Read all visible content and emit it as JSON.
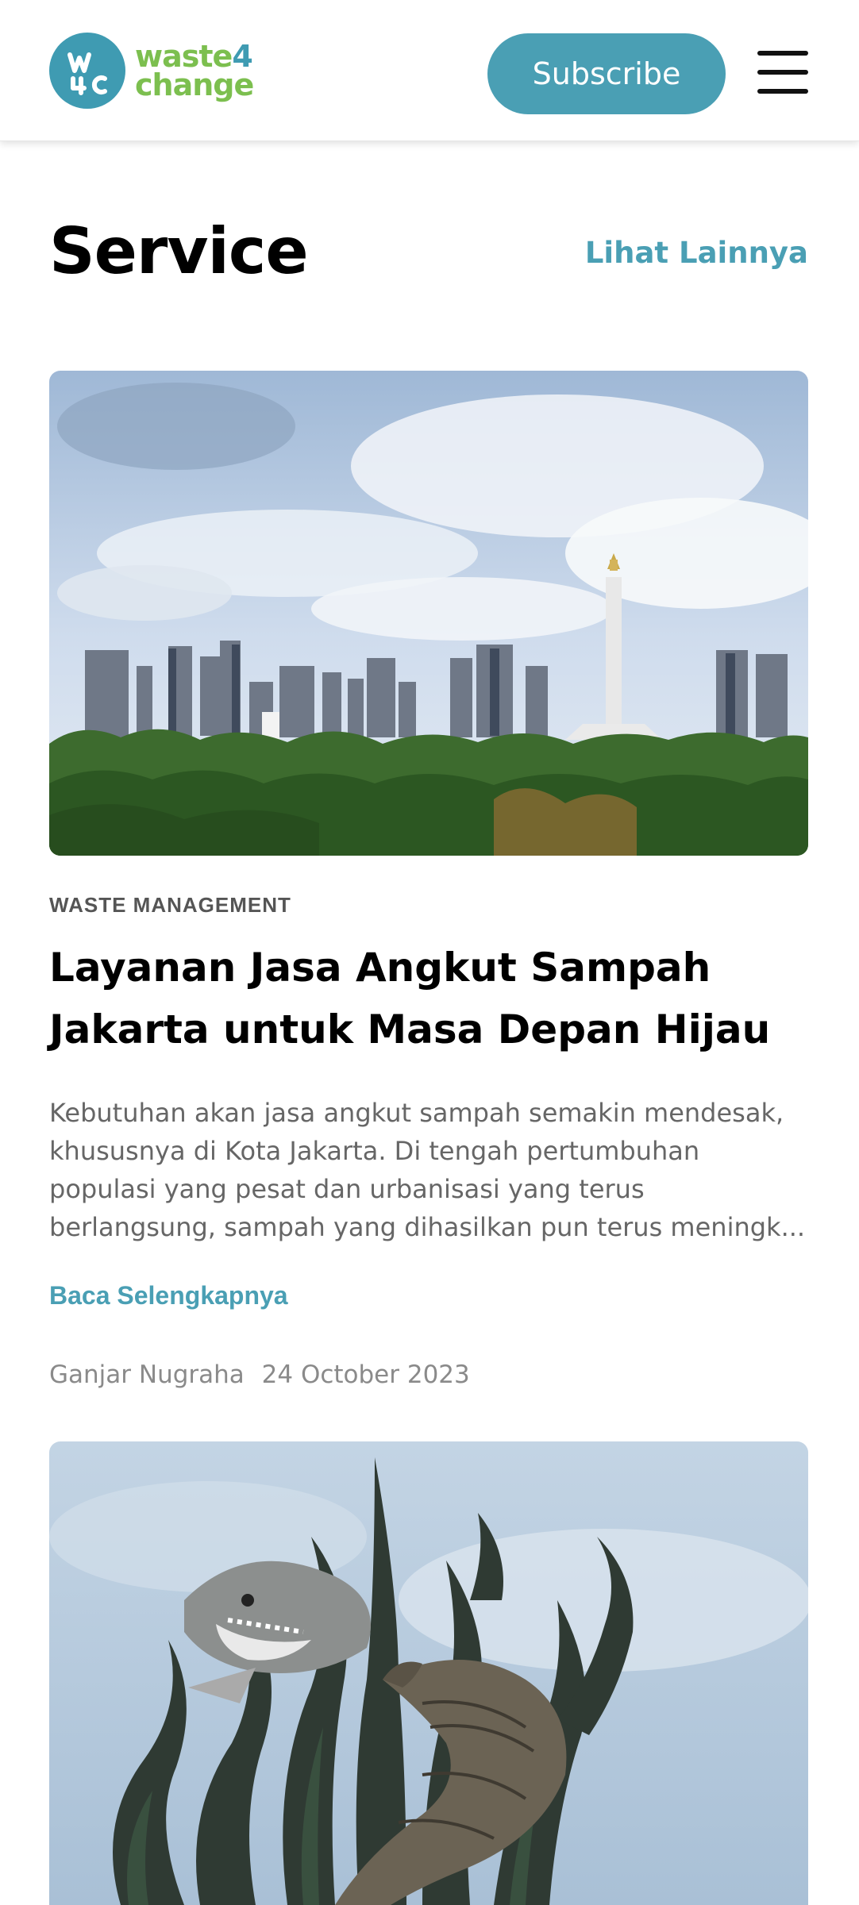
{
  "header": {
    "logo_text_line1": "waste",
    "logo_text_num": "4",
    "logo_text_line2": "change",
    "subscribe_label": "Subscribe",
    "menu_icon": "hamburger-menu-icon"
  },
  "section": {
    "title": "Service",
    "see_more_label": "Lihat Lainnya"
  },
  "articles": [
    {
      "image": "jakarta-skyline-monas-photo",
      "category": "WASTE MANAGEMENT",
      "title": "Layanan Jasa Angkut Sampah Jakarta untuk Masa Depan Hijau",
      "excerpt": "Kebutuhan akan jasa angkut sampah semakin mendesak, khususnya di Kota Jakarta. Di tengah pertumbuhan populasi yang pesat dan urbanisasi yang terus berlangsung, sampah yang dihasilkan pun terus meningk...",
      "read_more_label": "Baca Selengkapnya",
      "author": "Ganjar Nugraha",
      "date": "24 October 2023"
    },
    {
      "image": "surabaya-shark-crocodile-statue-photo"
    }
  ],
  "colors": {
    "brand_teal": "#4a9fb4",
    "brand_green": "#7cbf4f",
    "text_muted": "#666666"
  }
}
